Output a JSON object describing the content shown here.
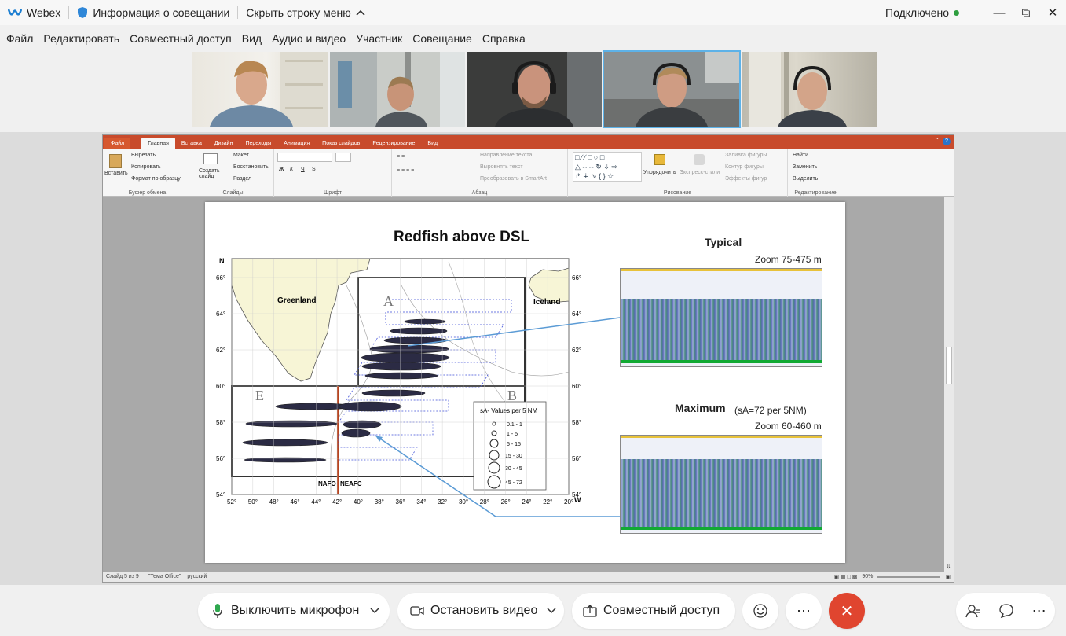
{
  "titlebar": {
    "app_name": "Webex",
    "meeting_info": "Информация о совещании",
    "hide_menu": "Скрыть строку меню",
    "status": "Подключено",
    "status_color": "#2e9e3f"
  },
  "menu": [
    "Файл",
    "Редактировать",
    "Совместный доступ",
    "Вид",
    "Аудио и видео",
    "Участник",
    "Совещание",
    "Справка"
  ],
  "participants": [
    {
      "name": "participant-1",
      "bg": "#e9e6de"
    },
    {
      "name": "participant-2",
      "bg": "#c9ccc8"
    },
    {
      "name": "participant-3",
      "bg": "#3c3d3c"
    },
    {
      "name": "participant-4",
      "bg": "#8a8f90"
    },
    {
      "name": "participant-5",
      "bg": "#c8c4b6"
    }
  ],
  "ppt": {
    "tabs": [
      "Файл",
      "Главная",
      "Вставка",
      "Дизайн",
      "Переходы",
      "Анимация",
      "Показ слайдов",
      "Рецензирование",
      "Вид"
    ],
    "clipboard": {
      "paste": "Вставить",
      "cut": "Вырезать",
      "copy": "Копировать",
      "format": "Формат по образцу",
      "label": "Буфер обмена"
    },
    "slides": {
      "new": "Создать слайд",
      "layout": "Макет",
      "reset": "Восстановить",
      "section": "Раздел",
      "label": "Слайды"
    },
    "font": {
      "label": "Шрифт"
    },
    "paragraph": {
      "direction": "Направление текста",
      "align": "Выровнять текст",
      "smartart": "Преобразовать в SmartArt",
      "label": "Абзац"
    },
    "drawing": {
      "arrange": "Упорядочить",
      "styles": "Экспресс-стили",
      "fill": "Заливка фигуры",
      "outline": "Контур фигуры",
      "effects": "Эффекты фигур",
      "label": "Рисование"
    },
    "editing": {
      "find": "Найти",
      "replace": "Заменить",
      "select": "Выделить",
      "label": "Редактирование"
    },
    "status": {
      "slide": "Слайд 5 из 9",
      "theme": "\"Тема Office\"",
      "lang": "русский",
      "zoom": "90%"
    }
  },
  "slide": {
    "title": "Redfish above DSL",
    "typical": "Typical",
    "zoom1": "Zoom 75-475 m",
    "maximum": "Maximum",
    "max_note": "(sA=72 per 5NM)",
    "zoom2": "Zoom 60-460 m",
    "map": {
      "north": "N",
      "greenland": "Greenland",
      "iceland": "Iceland",
      "west": "W",
      "zone_a": "A",
      "zone_b": "B",
      "zone_e": "E",
      "nafo": "NAFO",
      "neafc": "NEAFC",
      "lat_labels": [
        "66°",
        "64°",
        "62°",
        "60°",
        "58°",
        "56°",
        "54°"
      ],
      "lon_labels": [
        "52°",
        "50°",
        "48°",
        "46°",
        "44°",
        "42°",
        "40°",
        "38°",
        "36°",
        "34°",
        "32°",
        "30°",
        "28°",
        "26°",
        "24°",
        "22°",
        "20°"
      ],
      "legend_title": "sA- Values per 5 NM",
      "legend_items": [
        "0.1 - 1",
        "1 - 5",
        "5 - 15",
        "15 - 30",
        "30 - 45",
        "45 - 72"
      ]
    }
  },
  "controls": {
    "mute": "Выключить микрофон",
    "video": "Остановить видео",
    "share": "Совместный доступ",
    "end_color": "#e0452f"
  }
}
